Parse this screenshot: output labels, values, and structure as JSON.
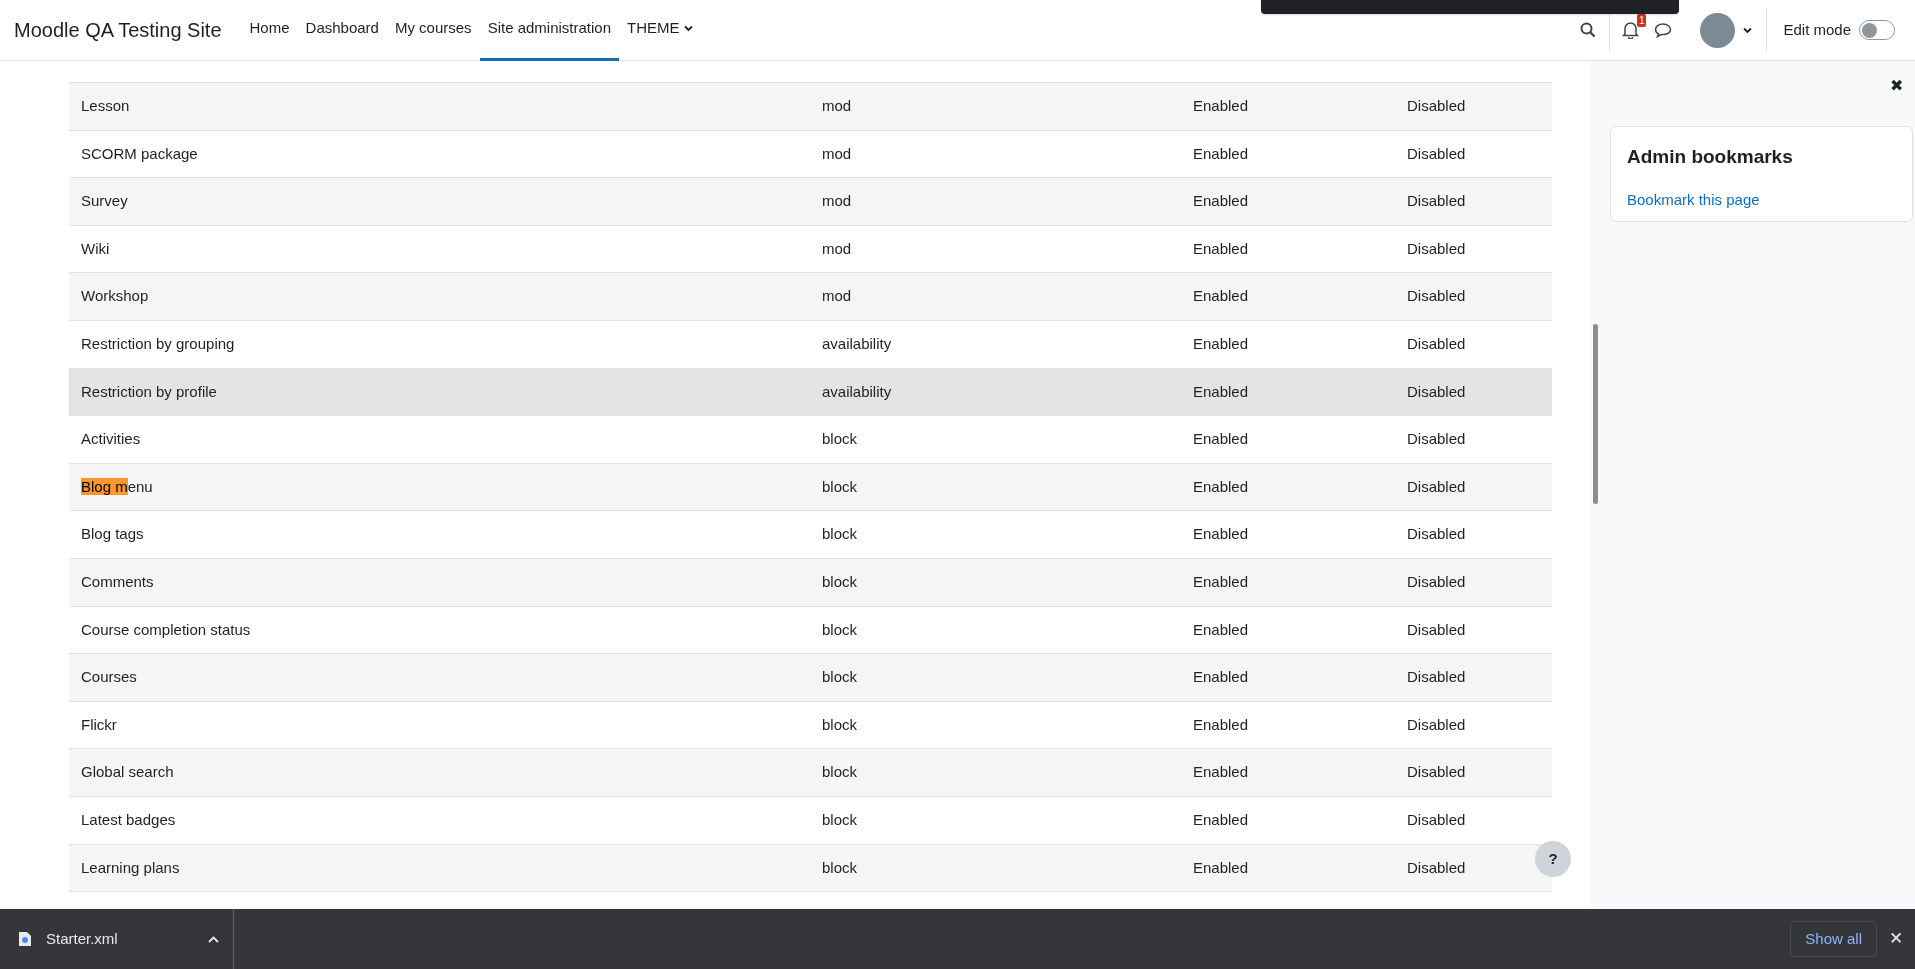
{
  "navbar": {
    "site_name": "Moodle QA Testing Site",
    "links": [
      {
        "label": "Home",
        "selected": false
      },
      {
        "label": "Dashboard",
        "selected": false
      },
      {
        "label": "My courses",
        "selected": false
      },
      {
        "label": "Site administration",
        "selected": true
      },
      {
        "label": "THEME",
        "selected": false,
        "dropdown": true
      }
    ],
    "notification_count": "1",
    "edit_mode": {
      "label": "Edit mode",
      "on": false
    }
  },
  "table": {
    "rows": [
      {
        "name": "Lesson",
        "type": "mod",
        "status": "Enabled",
        "default": "Disabled",
        "hovered": false
      },
      {
        "name": "SCORM package",
        "type": "mod",
        "status": "Enabled",
        "default": "Disabled",
        "hovered": false
      },
      {
        "name": "Survey",
        "type": "mod",
        "status": "Enabled",
        "default": "Disabled",
        "hovered": false
      },
      {
        "name": "Wiki",
        "type": "mod",
        "status": "Enabled",
        "default": "Disabled",
        "hovered": false
      },
      {
        "name": "Workshop",
        "type": "mod",
        "status": "Enabled",
        "default": "Disabled",
        "hovered": false
      },
      {
        "name": "Restriction by grouping",
        "type": "availability",
        "status": "Enabled",
        "default": "Disabled",
        "hovered": false
      },
      {
        "name": "Restriction by profile",
        "type": "availability",
        "status": "Enabled",
        "default": "Disabled",
        "hovered": true
      },
      {
        "name": "Activities",
        "type": "block",
        "status": "Enabled",
        "default": "Disabled",
        "hovered": false
      },
      {
        "highlight": "Blog m",
        "rest": "enu",
        "type": "block",
        "status": "Enabled",
        "default": "Disabled",
        "hovered": false
      },
      {
        "name": "Blog tags",
        "type": "block",
        "status": "Enabled",
        "default": "Disabled",
        "hovered": false
      },
      {
        "name": "Comments",
        "type": "block",
        "status": "Enabled",
        "default": "Disabled",
        "hovered": false
      },
      {
        "name": "Course completion status",
        "type": "block",
        "status": "Enabled",
        "default": "Disabled",
        "hovered": false
      },
      {
        "name": "Courses",
        "type": "block",
        "status": "Enabled",
        "default": "Disabled",
        "hovered": false
      },
      {
        "name": "Flickr",
        "type": "block",
        "status": "Enabled",
        "default": "Disabled",
        "hovered": false
      },
      {
        "name": "Global search",
        "type": "block",
        "status": "Enabled",
        "default": "Disabled",
        "hovered": false
      },
      {
        "name": "Latest badges",
        "type": "block",
        "status": "Enabled",
        "default": "Disabled",
        "hovered": false
      },
      {
        "name": "Learning plans",
        "type": "block",
        "status": "Enabled",
        "default": "Disabled",
        "hovered": false
      }
    ]
  },
  "help_button": "?",
  "drawer": {
    "close": "✖",
    "block_title": "Admin bookmarks",
    "link": "Bookmark this page"
  },
  "download_bar": {
    "file": "Starter.xml",
    "show_all": "Show all",
    "close": "✕"
  }
}
